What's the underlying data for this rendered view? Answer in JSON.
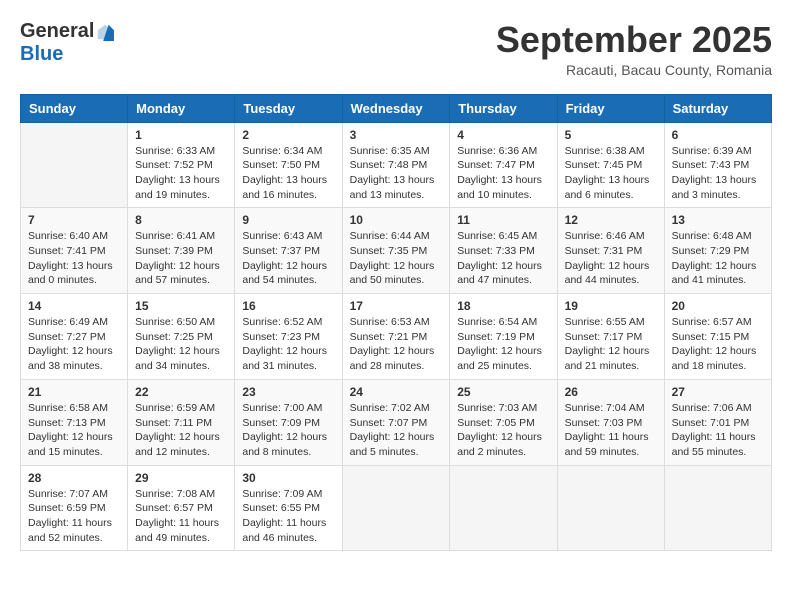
{
  "header": {
    "logo_general": "General",
    "logo_blue": "Blue",
    "month_title": "September 2025",
    "location": "Racauti, Bacau County, Romania"
  },
  "weekdays": [
    "Sunday",
    "Monday",
    "Tuesday",
    "Wednesday",
    "Thursday",
    "Friday",
    "Saturday"
  ],
  "weeks": [
    [
      {
        "day": "",
        "info": ""
      },
      {
        "day": "1",
        "info": "Sunrise: 6:33 AM\nSunset: 7:52 PM\nDaylight: 13 hours\nand 19 minutes."
      },
      {
        "day": "2",
        "info": "Sunrise: 6:34 AM\nSunset: 7:50 PM\nDaylight: 13 hours\nand 16 minutes."
      },
      {
        "day": "3",
        "info": "Sunrise: 6:35 AM\nSunset: 7:48 PM\nDaylight: 13 hours\nand 13 minutes."
      },
      {
        "day": "4",
        "info": "Sunrise: 6:36 AM\nSunset: 7:47 PM\nDaylight: 13 hours\nand 10 minutes."
      },
      {
        "day": "5",
        "info": "Sunrise: 6:38 AM\nSunset: 7:45 PM\nDaylight: 13 hours\nand 6 minutes."
      },
      {
        "day": "6",
        "info": "Sunrise: 6:39 AM\nSunset: 7:43 PM\nDaylight: 13 hours\nand 3 minutes."
      }
    ],
    [
      {
        "day": "7",
        "info": "Sunrise: 6:40 AM\nSunset: 7:41 PM\nDaylight: 13 hours\nand 0 minutes."
      },
      {
        "day": "8",
        "info": "Sunrise: 6:41 AM\nSunset: 7:39 PM\nDaylight: 12 hours\nand 57 minutes."
      },
      {
        "day": "9",
        "info": "Sunrise: 6:43 AM\nSunset: 7:37 PM\nDaylight: 12 hours\nand 54 minutes."
      },
      {
        "day": "10",
        "info": "Sunrise: 6:44 AM\nSunset: 7:35 PM\nDaylight: 12 hours\nand 50 minutes."
      },
      {
        "day": "11",
        "info": "Sunrise: 6:45 AM\nSunset: 7:33 PM\nDaylight: 12 hours\nand 47 minutes."
      },
      {
        "day": "12",
        "info": "Sunrise: 6:46 AM\nSunset: 7:31 PM\nDaylight: 12 hours\nand 44 minutes."
      },
      {
        "day": "13",
        "info": "Sunrise: 6:48 AM\nSunset: 7:29 PM\nDaylight: 12 hours\nand 41 minutes."
      }
    ],
    [
      {
        "day": "14",
        "info": "Sunrise: 6:49 AM\nSunset: 7:27 PM\nDaylight: 12 hours\nand 38 minutes."
      },
      {
        "day": "15",
        "info": "Sunrise: 6:50 AM\nSunset: 7:25 PM\nDaylight: 12 hours\nand 34 minutes."
      },
      {
        "day": "16",
        "info": "Sunrise: 6:52 AM\nSunset: 7:23 PM\nDaylight: 12 hours\nand 31 minutes."
      },
      {
        "day": "17",
        "info": "Sunrise: 6:53 AM\nSunset: 7:21 PM\nDaylight: 12 hours\nand 28 minutes."
      },
      {
        "day": "18",
        "info": "Sunrise: 6:54 AM\nSunset: 7:19 PM\nDaylight: 12 hours\nand 25 minutes."
      },
      {
        "day": "19",
        "info": "Sunrise: 6:55 AM\nSunset: 7:17 PM\nDaylight: 12 hours\nand 21 minutes."
      },
      {
        "day": "20",
        "info": "Sunrise: 6:57 AM\nSunset: 7:15 PM\nDaylight: 12 hours\nand 18 minutes."
      }
    ],
    [
      {
        "day": "21",
        "info": "Sunrise: 6:58 AM\nSunset: 7:13 PM\nDaylight: 12 hours\nand 15 minutes."
      },
      {
        "day": "22",
        "info": "Sunrise: 6:59 AM\nSunset: 7:11 PM\nDaylight: 12 hours\nand 12 minutes."
      },
      {
        "day": "23",
        "info": "Sunrise: 7:00 AM\nSunset: 7:09 PM\nDaylight: 12 hours\nand 8 minutes."
      },
      {
        "day": "24",
        "info": "Sunrise: 7:02 AM\nSunset: 7:07 PM\nDaylight: 12 hours\nand 5 minutes."
      },
      {
        "day": "25",
        "info": "Sunrise: 7:03 AM\nSunset: 7:05 PM\nDaylight: 12 hours\nand 2 minutes."
      },
      {
        "day": "26",
        "info": "Sunrise: 7:04 AM\nSunset: 7:03 PM\nDaylight: 11 hours\nand 59 minutes."
      },
      {
        "day": "27",
        "info": "Sunrise: 7:06 AM\nSunset: 7:01 PM\nDaylight: 11 hours\nand 55 minutes."
      }
    ],
    [
      {
        "day": "28",
        "info": "Sunrise: 7:07 AM\nSunset: 6:59 PM\nDaylight: 11 hours\nand 52 minutes."
      },
      {
        "day": "29",
        "info": "Sunrise: 7:08 AM\nSunset: 6:57 PM\nDaylight: 11 hours\nand 49 minutes."
      },
      {
        "day": "30",
        "info": "Sunrise: 7:09 AM\nSunset: 6:55 PM\nDaylight: 11 hours\nand 46 minutes."
      },
      {
        "day": "",
        "info": ""
      },
      {
        "day": "",
        "info": ""
      },
      {
        "day": "",
        "info": ""
      },
      {
        "day": "",
        "info": ""
      }
    ]
  ]
}
